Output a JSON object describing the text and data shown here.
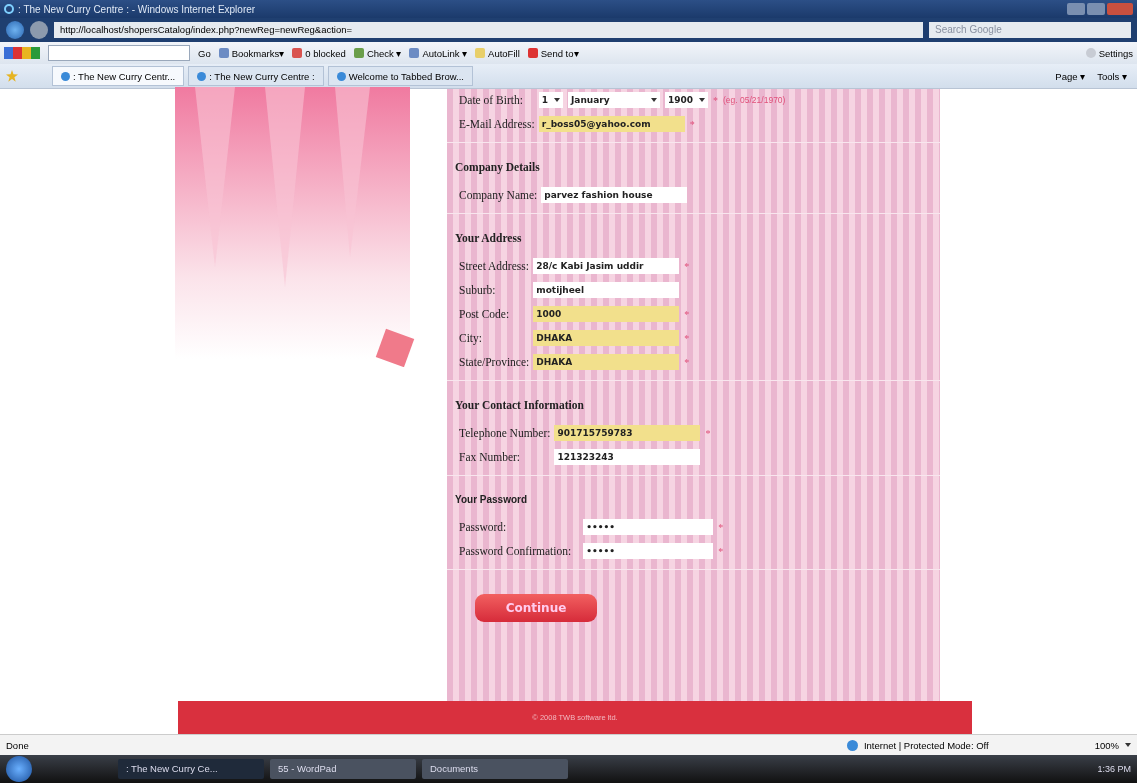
{
  "window": {
    "title": ": The New Curry Centre : - Windows Internet Explorer"
  },
  "address_bar": {
    "url": "http://localhost/shopersCatalog/index.php?newReg=newReg&action=",
    "search_placeholder": "Search Google"
  },
  "google_toolbar": {
    "items": [
      {
        "label": "Go",
        "kind": "text"
      },
      {
        "label": "Bookmarks▾",
        "kind": "star"
      },
      {
        "label": "0 blocked",
        "kind": "block"
      },
      {
        "label": "Check ▾",
        "kind": "check"
      },
      {
        "label": "AutoLink ▾",
        "kind": "link"
      },
      {
        "label": "AutoFill",
        "kind": "fill"
      },
      {
        "label": "Send to▾",
        "kind": "send"
      }
    ],
    "settings": "Settings"
  },
  "tabs": [
    {
      "label": ": The New Curry Centr...",
      "selected": true
    },
    {
      "label": ": The New Curry Centre :",
      "selected": false
    },
    {
      "label": "Welcome to Tabbed Brow...",
      "selected": false
    }
  ],
  "command_bar": [
    {
      "label": "Page ▾"
    },
    {
      "label": "Tools ▾"
    }
  ],
  "form": {
    "sections": [
      {
        "fields": [
          {
            "kind": "date",
            "label": "Date of Birth:",
            "selects": [
              "1",
              "January",
              "1900"
            ],
            "mark": "*",
            "hint": "(eg. 05/21/1970)"
          },
          {
            "kind": "text",
            "label": "E-Mail Address:",
            "value": "r_boss05@yahoo.com",
            "highlighted": true,
            "mark": "*"
          }
        ]
      },
      {
        "heading": "Company Details",
        "sans_heading": false,
        "fields": [
          {
            "kind": "text",
            "label": "Company Name:",
            "value": "parvez fashion house",
            "highlighted": false
          }
        ]
      },
      {
        "heading": "Your Address",
        "sans_heading": false,
        "fields": [
          {
            "kind": "text",
            "label": "Street Address:",
            "value": "28/c Kabi Jasim uddir",
            "highlighted": false,
            "mark": "*"
          },
          {
            "kind": "text",
            "label": "Suburb:",
            "value": "motijheel",
            "highlighted": false
          },
          {
            "kind": "text",
            "label": "Post Code:",
            "value": "1000",
            "highlighted": true,
            "mark": "*"
          },
          {
            "kind": "text",
            "label": "City:",
            "value": "DHAKA",
            "highlighted": true,
            "mark": "*"
          },
          {
            "kind": "text",
            "label": "State/Province:",
            "value": "DHAKA",
            "highlighted": true,
            "mark": "*"
          }
        ]
      },
      {
        "heading": "Your Contact Information",
        "sans_heading": false,
        "fields": [
          {
            "kind": "text",
            "label": "Telephone Number:",
            "value": "901715759783",
            "highlighted": true,
            "mark": "*"
          },
          {
            "kind": "text",
            "label": "Fax Number:",
            "value": "121323243",
            "highlighted": false
          }
        ]
      },
      {
        "heading": "Your Password",
        "sans_heading": true,
        "fields": [
          {
            "kind": "password",
            "label": "Password:",
            "value": "•••••",
            "highlighted": false,
            "mark": "*"
          },
          {
            "kind": "password",
            "label": "Password Confirmation:",
            "value": "•••••",
            "highlighted": false,
            "mark": "*"
          }
        ]
      }
    ],
    "button": "Continue"
  },
  "footer": "© 2008 TWB software ltd.",
  "status_bar": {
    "text": "Done",
    "zone": "Internet | Protected Mode: Off",
    "zoom": "100%"
  },
  "taskbar": {
    "items": [
      {
        "label": ": The New Curry Ce...",
        "selected": true
      },
      {
        "label": "55 - WordPad",
        "selected": false
      },
      {
        "label": "Documents",
        "selected": false
      }
    ],
    "clock": "1:36 PM"
  }
}
